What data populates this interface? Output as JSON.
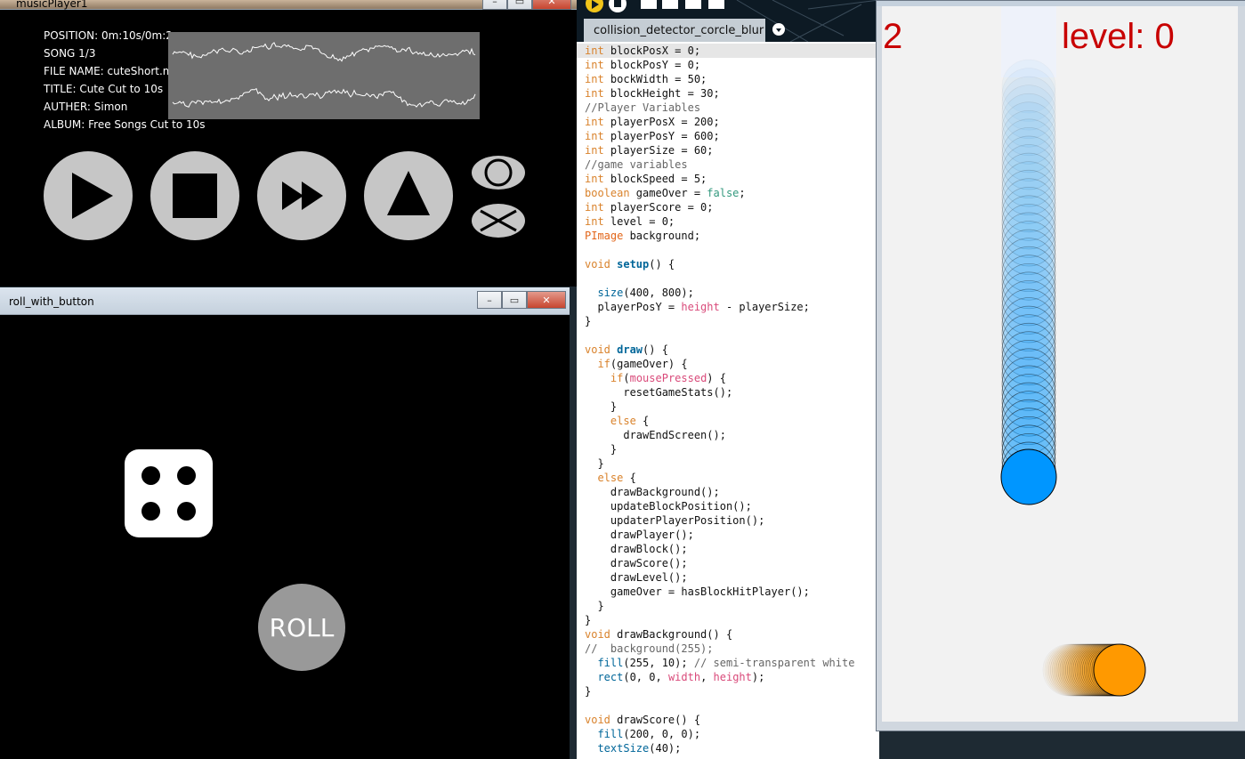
{
  "music_player": {
    "title": "musicPlayer1",
    "info": {
      "position": "POSITION: 0m:10s/0m:2",
      "song": "SONG 1/3",
      "file": "FILE NAME: cuteShort.mp",
      "title": "TITLE: Cute Cut to 10s",
      "auther": "AUTHER: Simon",
      "album": "ALBUM: Free Songs Cut to 10s"
    },
    "buttons": [
      "play",
      "stop",
      "fast-forward",
      "eject",
      "loop",
      "shuffle"
    ]
  },
  "roll_window": {
    "title": "roll_with_button",
    "die_value": 4,
    "roll_label": "ROLL"
  },
  "ide": {
    "tab": "collision_detector_corcle_blur",
    "lines": [
      [
        [
          "kw",
          "int"
        ],
        [
          "",
          "blockPosX = 0;"
        ]
      ],
      [
        [
          "kw",
          "int"
        ],
        [
          "",
          "blockPosY = 0;"
        ]
      ],
      [
        [
          "kw",
          "int"
        ],
        [
          "",
          "bockWidth = 50;"
        ]
      ],
      [
        [
          "kw",
          "int"
        ],
        [
          "",
          "blockHeight = 30;"
        ]
      ],
      [
        [
          "cm",
          "//Player Variables"
        ]
      ],
      [
        [
          "kw",
          "int"
        ],
        [
          "",
          "playerPosX = 200;"
        ]
      ],
      [
        [
          "kw",
          "int"
        ],
        [
          "",
          "playerPosY = 600;"
        ]
      ],
      [
        [
          "kw",
          "int"
        ],
        [
          "",
          "playerSize = 60;"
        ]
      ],
      [
        [
          "cm",
          "//game variables"
        ]
      ],
      [
        [
          "kw",
          "int"
        ],
        [
          "",
          "blockSpeed = 5;"
        ]
      ],
      [
        [
          "kw",
          "boolean"
        ],
        [
          "",
          "gameOver = "
        ],
        [
          "kw2",
          "false"
        ],
        [
          "",
          ";"
        ]
      ],
      [
        [
          "kw",
          "int"
        ],
        [
          "",
          "playerScore = 0;"
        ]
      ],
      [
        [
          "kw",
          "int"
        ],
        [
          "",
          "level = 0;"
        ]
      ],
      [
        [
          "pimg",
          "PImage"
        ],
        [
          "",
          "background;"
        ]
      ],
      [
        [
          "",
          ""
        ]
      ],
      [
        [
          "kw",
          "void"
        ],
        [
          "fn",
          "setup"
        ],
        [
          "",
          "() {"
        ]
      ],
      [
        [
          "",
          ""
        ]
      ],
      [
        [
          "",
          "  "
        ],
        [
          "fn2",
          "size"
        ],
        [
          "",
          "(400, 800);"
        ]
      ],
      [
        [
          "",
          "  playerPosY = "
        ],
        [
          "pk",
          "height"
        ],
        [
          "",
          ""
        ],
        [
          "",
          "- playerSize;"
        ]
      ],
      [
        [
          "",
          "}"
        ]
      ],
      [
        [
          "",
          ""
        ]
      ],
      [
        [
          "kw",
          "void"
        ],
        [
          "fn",
          "draw"
        ],
        [
          "",
          "() {"
        ]
      ],
      [
        [
          "",
          "  "
        ],
        [
          "kw",
          "if"
        ],
        [
          "",
          "(gameOver) {"
        ]
      ],
      [
        [
          "",
          "    "
        ],
        [
          "kw",
          "if"
        ],
        [
          "",
          "("
        ],
        [
          "pk",
          "mousePressed"
        ],
        [
          "",
          ") {"
        ]
      ],
      [
        [
          "",
          "      resetGameStats();"
        ]
      ],
      [
        [
          "",
          "    }"
        ]
      ],
      [
        [
          "",
          "    "
        ],
        [
          "kw",
          "else"
        ],
        [
          "",
          "{"
        ]
      ],
      [
        [
          "",
          "      drawEndScreen();"
        ]
      ],
      [
        [
          "",
          "    }"
        ]
      ],
      [
        [
          "",
          "  }"
        ]
      ],
      [
        [
          "",
          "  "
        ],
        [
          "kw",
          "else"
        ],
        [
          "",
          "{"
        ]
      ],
      [
        [
          "",
          "    drawBackground();"
        ]
      ],
      [
        [
          "",
          "    updateBlockPosition();"
        ]
      ],
      [
        [
          "",
          "    updaterPlayerPosition();"
        ]
      ],
      [
        [
          "",
          "    drawPlayer();"
        ]
      ],
      [
        [
          "",
          "    drawBlock();"
        ]
      ],
      [
        [
          "",
          "    drawScore();"
        ]
      ],
      [
        [
          "",
          "    drawLevel();"
        ]
      ],
      [
        [
          "",
          "    gameOver = hasBlockHitPlayer();"
        ]
      ],
      [
        [
          "",
          "  }"
        ]
      ],
      [
        [
          "",
          "}"
        ]
      ],
      [
        [
          "kw",
          "void"
        ],
        [
          "",
          "drawBackground() {"
        ]
      ],
      [
        [
          "cm",
          "//  background(255);"
        ]
      ],
      [
        [
          "",
          "  "
        ],
        [
          "fn2",
          "fill"
        ],
        [
          "",
          "(255, 10); "
        ],
        [
          "cm",
          "// semi-transparent white"
        ]
      ],
      [
        [
          "",
          "  "
        ],
        [
          "fn2",
          "rect"
        ],
        [
          "",
          "(0, 0, "
        ],
        [
          "pk",
          "width"
        ],
        [
          "",
          ", "
        ],
        [
          "pk",
          "height"
        ],
        [
          "",
          ");"
        ]
      ],
      [
        [
          "",
          "}"
        ]
      ],
      [
        [
          "",
          ""
        ]
      ],
      [
        [
          "kw",
          "void"
        ],
        [
          "",
          "drawScore() {"
        ]
      ],
      [
        [
          "",
          "  "
        ],
        [
          "fn2",
          "fill"
        ],
        [
          "",
          "(200, 0, 0);"
        ]
      ],
      [
        [
          "",
          "  "
        ],
        [
          "fn2",
          "textSize"
        ],
        [
          "",
          "(40);"
        ]
      ]
    ]
  },
  "game": {
    "score": "2",
    "level_text": "level: 0",
    "player_color": "#0096ff",
    "block_color": "#ff9900"
  }
}
